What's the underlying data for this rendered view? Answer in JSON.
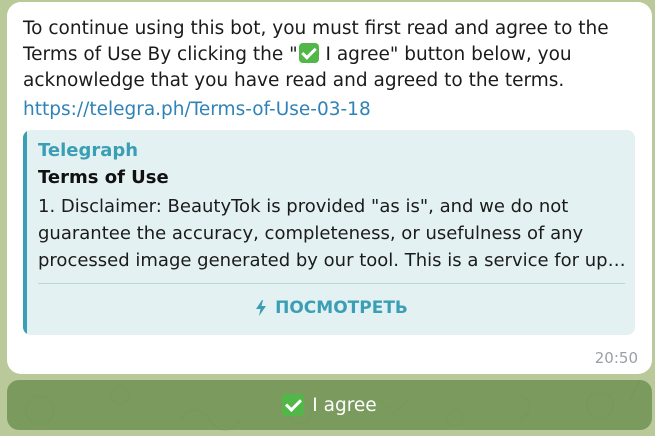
{
  "message": {
    "text_before_icon": "To continue using this bot, you must first read and agree to the Terms of Use By clicking the \"",
    "inline_icon": "check-mark-button-emoji",
    "text_after_icon": " I agree\" button below, you acknowledge that you have read and agreed to the terms.",
    "link": "https://telegra.ph/Terms-of-Use-03-18",
    "time": "20:50"
  },
  "link_preview": {
    "site_name": "Telegraph",
    "title": "Terms of Use",
    "description_line1": "1. Disclaimer: BeautyTok is provided \"as is\", and we do not",
    "description_line2": "guarantee the accuracy, completeness, or usefulness of any",
    "description_line3": "processed image generated by our tool. This is a service for upgrading and improving images",
    "action_label": "ПОСМОТРЕТЬ",
    "action_icon": "lightning-icon"
  },
  "keyboard": {
    "button_label": "I agree",
    "button_icon": "check-mark-button-emoji"
  },
  "colors": {
    "accent": "#3a9fb4",
    "link": "#2f83b7",
    "wallpaper": "#b9c99a",
    "button_bg": "#688e4c"
  }
}
